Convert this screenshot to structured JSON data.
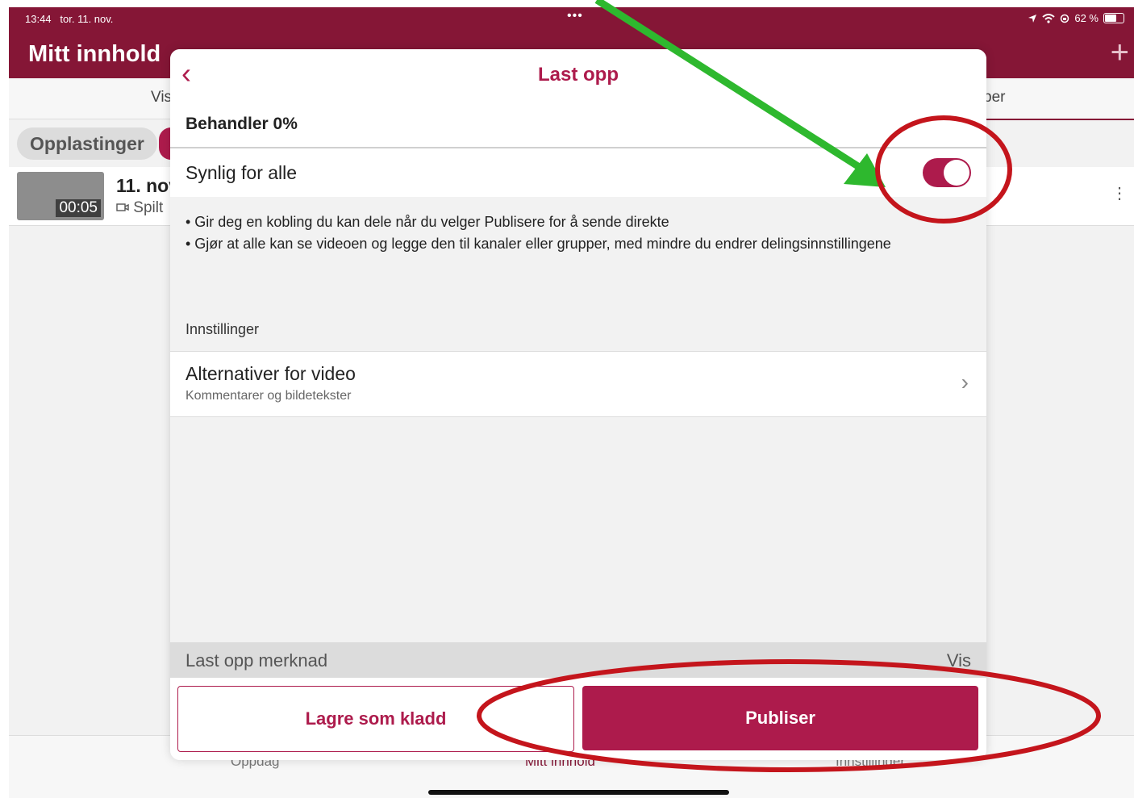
{
  "status_bar": {
    "time": "13:44",
    "date": "tor. 11. nov.",
    "dots": "•••",
    "battery": "62 %"
  },
  "navbar": {
    "title": "Mitt innhold",
    "plus": "+"
  },
  "tabs": {
    "left_partial": "Vis",
    "right_partial": "per"
  },
  "chip": {
    "label": "Opplastinger"
  },
  "list": {
    "item": {
      "title": "11. nov",
      "subtitle": "Spilt",
      "duration": "00:05",
      "more": "⋮"
    }
  },
  "bottom_tabs": {
    "discover": "Oppdag",
    "my_content": "Mitt innhold",
    "settings": "Innstillinger"
  },
  "modal": {
    "title": "Last opp",
    "back": "‹",
    "progress": "Behandler 0%",
    "visible_label": "Synlig for alle",
    "visible_on": true,
    "desc1": "• Gir deg en kobling du kan dele når du velger Publisere for å sende direkte",
    "desc2": "• Gjør at alle kan se videoen og legge den til kanaler eller grupper, med mindre du endrer delingsinnstillingene",
    "section_label": "Innstillinger",
    "option_title": "Alternativer for video",
    "option_subtitle": "Kommentarer og bildetekster",
    "chevron": "›",
    "note_label": "Last opp merknad",
    "note_action": "Vis",
    "btn_draft": "Lagre som kladd",
    "btn_publish": "Publiser"
  },
  "colors": {
    "brand": "#851636",
    "accent": "#ad1b4c",
    "annotation_red": "#c4151c",
    "annotation_green": "#2eb82e"
  }
}
